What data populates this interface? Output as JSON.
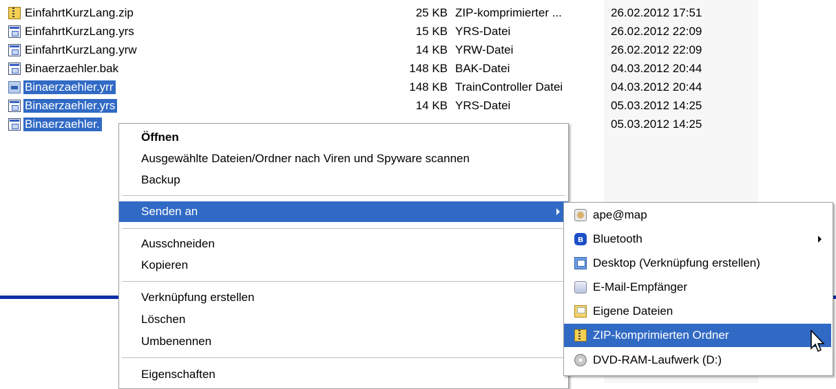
{
  "files": [
    {
      "name": "EinfahrtKurzLang.zip",
      "size": "25 KB",
      "type": "ZIP-komprimierter ...",
      "date": "26.02.2012 17:51",
      "icon": "zip-icon",
      "selected": false
    },
    {
      "name": "EinfahrtKurzLang.yrs",
      "size": "15 KB",
      "type": "YRS-Datei",
      "date": "26.02.2012 22:09",
      "icon": "document-icon",
      "selected": false
    },
    {
      "name": "EinfahrtKurzLang.yrw",
      "size": "14 KB",
      "type": "YRW-Datei",
      "date": "26.02.2012 22:09",
      "icon": "document-icon",
      "selected": false
    },
    {
      "name": "Binaerzaehler.bak",
      "size": "148 KB",
      "type": "BAK-Datei",
      "date": "04.03.2012 20:44",
      "icon": "document-icon",
      "selected": false
    },
    {
      "name": "Binaerzaehler.yrr",
      "size": "148 KB",
      "type": "TrainController Datei",
      "date": "04.03.2012 20:44",
      "icon": "traincontroller-icon",
      "selected": true
    },
    {
      "name": "Binaerzaehler.yrs",
      "size": "14 KB",
      "type": "YRS-Datei",
      "date": "05.03.2012 14:25",
      "icon": "document-icon",
      "selected": true
    },
    {
      "name": "Binaerzaehler.",
      "size": "",
      "type": "",
      "date": "05.03.2012 14:25",
      "icon": "document-icon",
      "selected": true
    }
  ],
  "context_menu": {
    "open": "Öffnen",
    "scan": "Ausgewählte Dateien/Ordner nach Viren und Spyware scannen",
    "backup": "Backup",
    "send_to": "Senden an",
    "cut": "Ausschneiden",
    "copy": "Kopieren",
    "create_shortcut": "Verknüpfung erstellen",
    "delete": "Löschen",
    "rename": "Umbenennen",
    "properties": "Eigenschaften"
  },
  "send_to_menu": {
    "items": [
      {
        "label": "ape@map",
        "icon": "apemap-icon"
      },
      {
        "label": "Bluetooth",
        "icon": "bluetooth-icon",
        "has_submenu": true
      },
      {
        "label": "Desktop (Verknüpfung erstellen)",
        "icon": "desktop-icon"
      },
      {
        "label": "E-Mail-Empfänger",
        "icon": "mail-icon"
      },
      {
        "label": "Eigene Dateien",
        "icon": "my-documents-icon"
      },
      {
        "label": "ZIP-komprimierten Ordner",
        "icon": "zip-folder-icon",
        "highlighted": true
      },
      {
        "label": "DVD-RAM-Laufwerk (D:)",
        "icon": "dvd-drive-icon"
      }
    ]
  },
  "colors": {
    "selection": "#316ac5",
    "date_column": "#f7f7f7",
    "divider": "#0a2fa8"
  }
}
